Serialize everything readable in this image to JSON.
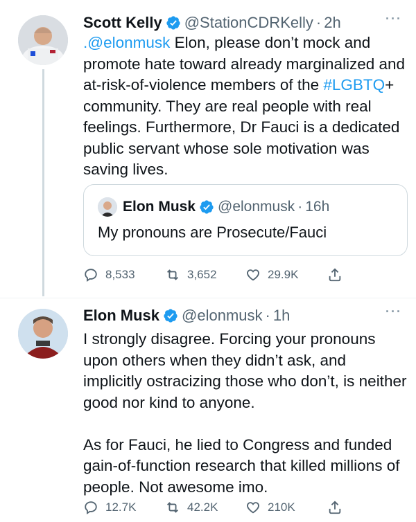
{
  "tweet1": {
    "name": "Scott Kelly",
    "handle": "@StationCDRKelly",
    "time": "2h",
    "more": "···",
    "text_mention": ".@elonmusk",
    "text_part1": " Elon, please don’t mock and promote hate toward already marginalized and at-risk-of-violence members of the ",
    "hashtag": "#LGBTQ",
    "text_part2": "+ community. They are real people with real feelings. Furthermore, Dr Fauci is a dedicated public servant whose sole motivation was saving lives.",
    "quote": {
      "name": "Elon Musk",
      "handle": "@elonmusk",
      "time": "16h",
      "text": "My pronouns are Prosecute/Fauci"
    },
    "replies": "8,533",
    "retweets": "3,652",
    "likes": "29.9K"
  },
  "tweet2": {
    "name": "Elon Musk",
    "handle": "@elonmusk",
    "time": "1h",
    "more": "···",
    "text": "I strongly disagree. Forcing your pronouns upon others when they didn’t ask, and implicitly ostracizing those who don’t, is neither good nor kind to anyone.\n\nAs for Fauci, he lied to Congress and funded gain-of-function research that killed millions of people. Not awesome imo.",
    "replies": "12.7K",
    "retweets": "42.2K",
    "likes": "210K"
  },
  "colors": {
    "link": "#1d9bf0",
    "verified": "#1d9bf0",
    "secondary_text": "#536471",
    "border": "#cfd9de"
  },
  "icons": {
    "reply": "reply-icon",
    "retweet": "retweet-icon",
    "like": "heart-icon",
    "share": "share-icon",
    "verified": "verified-badge-icon"
  }
}
